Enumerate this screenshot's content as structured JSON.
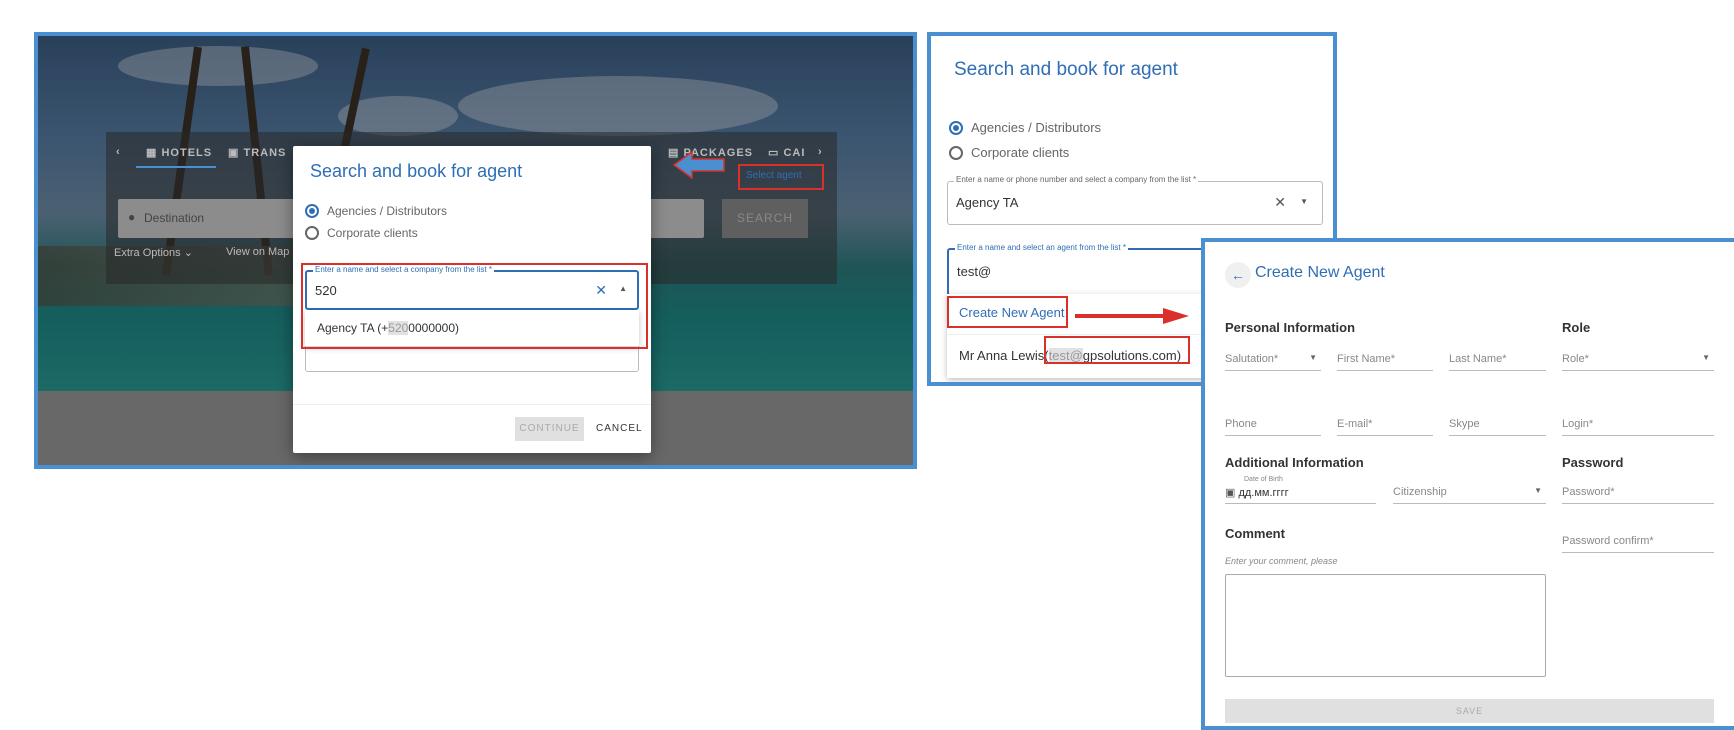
{
  "panel1": {
    "tabs": [
      {
        "label": "HOTELS",
        "icon": "building-icon"
      },
      {
        "label": "TRANS",
        "icon": "bus-icon"
      },
      {
        "label": "PACKAGES",
        "icon": "suitcase-icon"
      },
      {
        "label": "CAI",
        "icon": "car-icon"
      }
    ],
    "destination_placeholder": "Destination",
    "search_label": "SEARCH",
    "extra_options": "Extra Options",
    "view_on_map": "View on Map",
    "select_agent": "Select agent",
    "dialog": {
      "title": "Search and book for agent",
      "radios": [
        {
          "label": "Agencies / Distributors",
          "checked": true
        },
        {
          "label": "Corporate clients",
          "checked": false
        }
      ],
      "company_field_label": "Enter a name and select a company from the list *",
      "company_field_value": "520",
      "option_prefix": "Agency TA (+",
      "option_match": "520",
      "option_suffix": "0000000)",
      "continue_label": "CONTINUE",
      "cancel_label": "CANCEL"
    }
  },
  "panel2": {
    "title": "Search and book for agent",
    "radios": [
      {
        "label": "Agencies / Distributors",
        "checked": true
      },
      {
        "label": "Corporate clients",
        "checked": false
      }
    ],
    "company_field_label": "Enter a name or phone number and select a company from the list *",
    "company_field_value": "Agency TA",
    "agent_field_label": "Enter a name and select an agent from the list *",
    "agent_field_value": "test@",
    "create_new_agent": "Create New Agent",
    "agent_option_name": "Mr Anna Lewis",
    "agent_option_open": "(",
    "agent_option_match": "test@",
    "agent_option_rest": "gpsolutions.com)"
  },
  "panel3": {
    "title": "Create New Agent",
    "personal_information": "Personal Information",
    "role_heading": "Role",
    "salutation": "Salutation*",
    "first_name": "First Name*",
    "last_name": "Last Name*",
    "role": "Role*",
    "phone": "Phone",
    "email": "E-mail*",
    "skype": "Skype",
    "login": "Login*",
    "additional_information": "Additional Information",
    "password_heading": "Password",
    "date_of_birth_label": "Date of Birth",
    "date_of_birth_placeholder": "дд.мм.гггг",
    "citizenship": "Citizenship",
    "password": "Password*",
    "password_confirm": "Password confirm*",
    "comment_heading": "Comment",
    "comment_hint": "Enter your comment, please",
    "save_label": "SAVE"
  },
  "colors": {
    "accent": "#2f6eb5",
    "frame": "#4a90d0",
    "highlight": "#d9302b"
  }
}
